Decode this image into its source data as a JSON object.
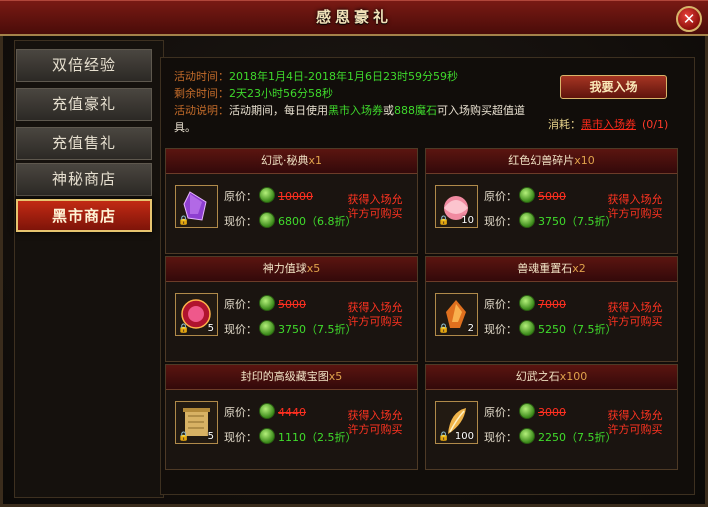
{
  "window": {
    "title": "感恩豪礼",
    "close_symbol": "✕"
  },
  "sidebar": {
    "items": [
      {
        "label": "双倍经验"
      },
      {
        "label": "充值豪礼"
      },
      {
        "label": "充值售礼"
      },
      {
        "label": "神秘商店"
      },
      {
        "label": "黑市商店"
      }
    ],
    "active_index": 4
  },
  "event": {
    "time_label": "活动时间：",
    "time_value": "2018年1月4日-2018年1月6日23时59分59秒",
    "remain_label": "剩余时间：",
    "remain_value": "2天23小时56分58秒",
    "desc_label": "活动说明：",
    "desc_part1": "活动期间，每日使用",
    "desc_ticket": "黑市入场券",
    "desc_part2": "或",
    "desc_gems": "888魔石",
    "desc_part3": "可入场购买超值道",
    "desc_part4": "具。"
  },
  "enter_button": "我要入场",
  "cost": {
    "label": "消耗：",
    "ticket": "黑市入场券",
    "count": "(0/1)"
  },
  "labels": {
    "original": "原价：",
    "current": "现价："
  },
  "items": [
    {
      "name": "幻武·秘典",
      "qty": "x1",
      "original": "10000",
      "current": "6800（6.8折）",
      "note": "获得入场允许方可购买",
      "count": ""
    },
    {
      "name": "红色幻兽碎片",
      "qty": "x10",
      "original": "5000",
      "current": "3750（7.5折）",
      "note": "获得入场允许方可购买",
      "count": "10"
    },
    {
      "name": "神力值球",
      "qty": "x5",
      "original": "5000",
      "current": "3750（7.5折）",
      "note": "获得入场允许方可购买",
      "count": "5"
    },
    {
      "name": "兽魂重置石",
      "qty": "x2",
      "original": "7000",
      "current": "5250（7.5折）",
      "note": "获得入场允许方可购买",
      "count": "2"
    },
    {
      "name": "封印的高级藏宝图",
      "qty": "x5",
      "original": "4440",
      "current": "1110（2.5折）",
      "note": "获得入场允许方可购买",
      "count": "5"
    },
    {
      "name": "幻武之石",
      "qty": "x100",
      "original": "3000",
      "current": "2250（7.5折）",
      "note": "获得入场允许方可购买",
      "count": "100"
    }
  ],
  "icons": [
    "purple-gem-icon",
    "pink-crystal-icon",
    "red-orb-icon",
    "amber-stone-icon",
    "treasure-map-icon",
    "golden-feather-icon"
  ],
  "colors": {
    "accent_red": "#7e1409",
    "price_green": "#40dc2c",
    "strike_red": "#ff2f20",
    "gold_border": "#d9b56a"
  }
}
